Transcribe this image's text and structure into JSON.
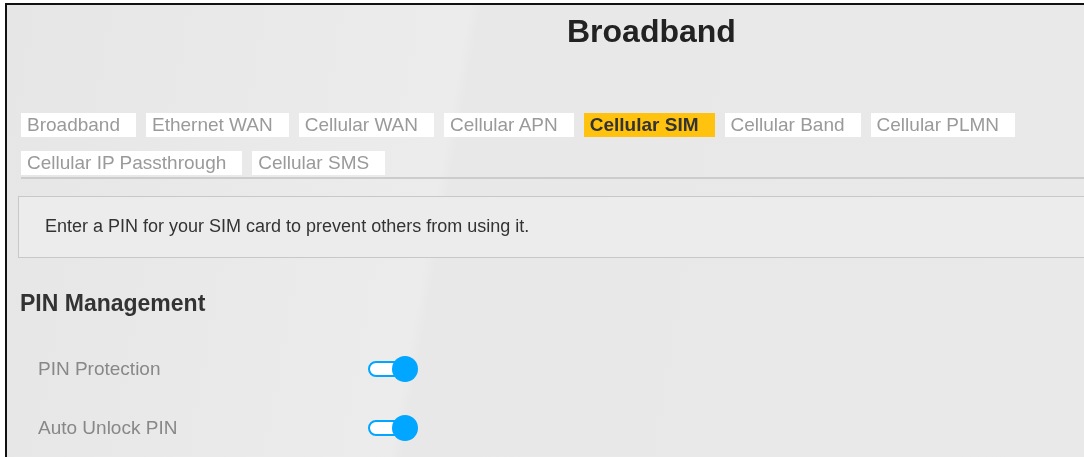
{
  "page_title": "Broadband",
  "tabs": [
    {
      "label": "Broadband",
      "selected": false
    },
    {
      "label": "Ethernet WAN",
      "selected": false
    },
    {
      "label": "Cellular WAN",
      "selected": false
    },
    {
      "label": "Cellular APN",
      "selected": false
    },
    {
      "label": "Cellular SIM",
      "selected": true
    },
    {
      "label": "Cellular Band",
      "selected": false
    },
    {
      "label": "Cellular PLMN",
      "selected": false
    },
    {
      "label": "Cellular IP Passthrough",
      "selected": false
    },
    {
      "label": "Cellular SMS",
      "selected": false
    }
  ],
  "info": "Enter a PIN for your SIM card to prevent others from using it.",
  "section": {
    "title": "PIN Management",
    "settings": [
      {
        "label": "PIN Protection",
        "on": true
      },
      {
        "label": "Auto Unlock PIN",
        "on": true
      }
    ]
  }
}
